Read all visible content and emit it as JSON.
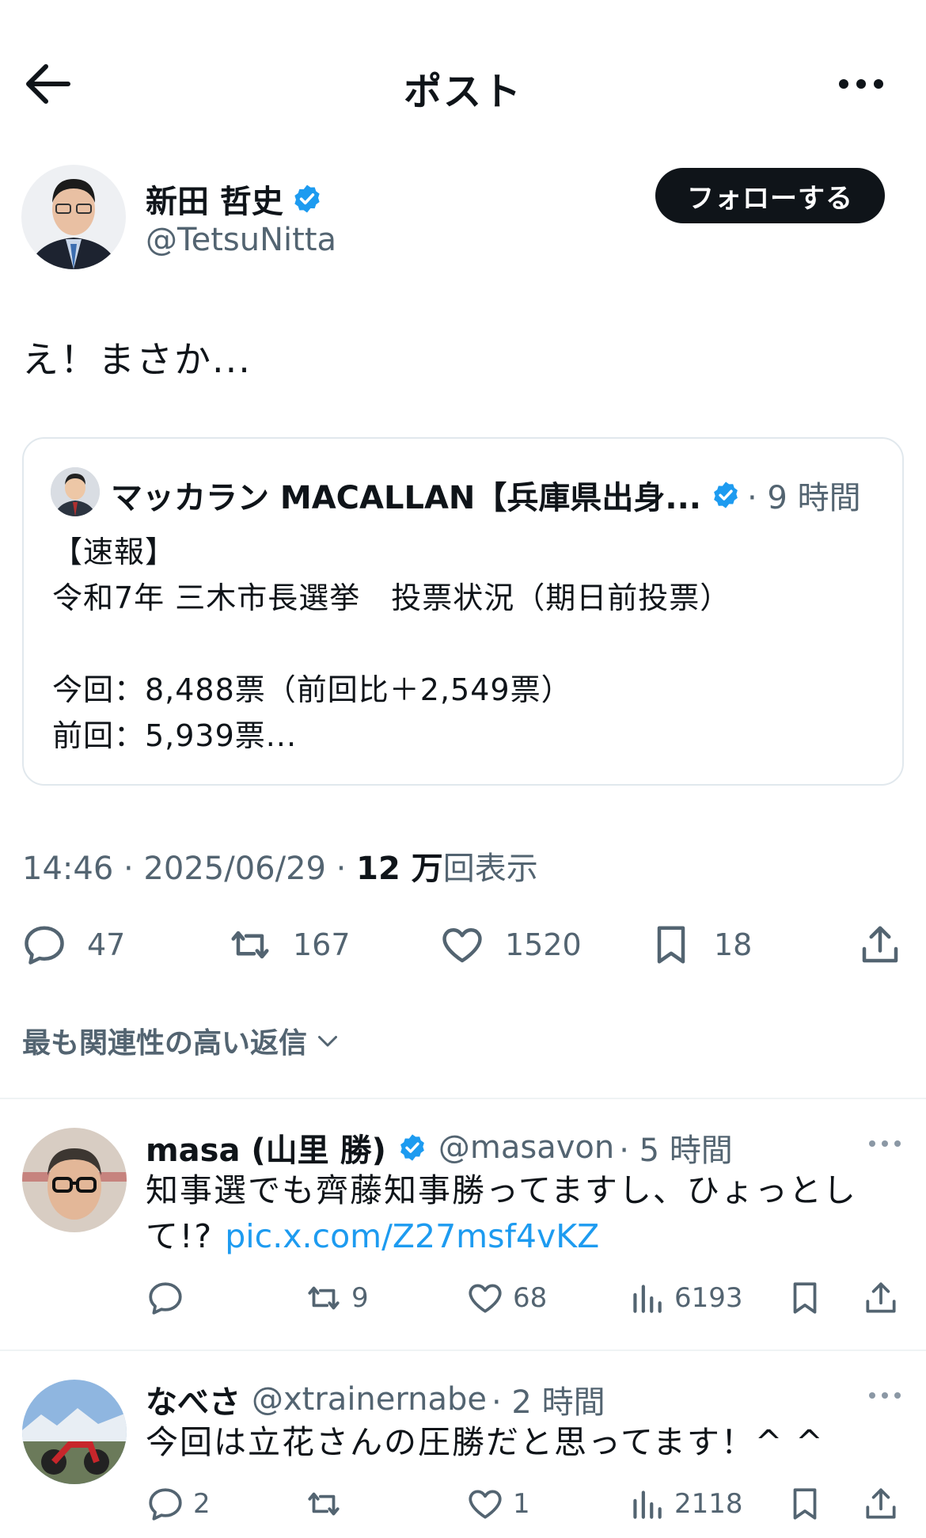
{
  "header": {
    "title": "ポスト"
  },
  "author": {
    "name": "新田 哲史",
    "handle": "@TetsuNitta",
    "follow_label": "フォローする"
  },
  "post": {
    "text": "え！まさか..."
  },
  "quote": {
    "author": "マッカラン MACALLAN【兵庫県出身...",
    "time": "· 9 時間",
    "body": "【速報】\n令和7年 三木市長選挙　投票状況（期日前投票）\n\n今回：8,488票（前回比＋2,549票）\n前回：5,939票..."
  },
  "meta": {
    "datetime": "14:46 · 2025/06/29 · ",
    "views_count": "12 万",
    "views_label": "回表示"
  },
  "actions": {
    "replies": "47",
    "reposts": "167",
    "likes": "1520",
    "bookmarks": "18"
  },
  "sort_label": "最も関連性の高い返信",
  "replies": [
    {
      "name": "masa (山里 勝)",
      "handle": "@masavon",
      "time": "· 5 時間",
      "text": "知事選でも齊藤知事勝ってますし、ひょっとして!? ",
      "link": "pic.x.com/Z27msf4vKZ",
      "reply_count": "",
      "repost_count": "9",
      "like_count": "68",
      "view_count": "6193"
    },
    {
      "name": "なべさ",
      "handle": "@xtrainernabe",
      "time": "· 2 時間",
      "text": "今回は立花さんの圧勝だと思ってます！^ ^",
      "reply_count": "2",
      "repost_count": "",
      "like_count": "1",
      "view_count": "2118"
    }
  ],
  "colors": {
    "accent": "#1d9bf0",
    "text": "#0f1419",
    "muted": "#536471",
    "border": "#eff3f4"
  }
}
